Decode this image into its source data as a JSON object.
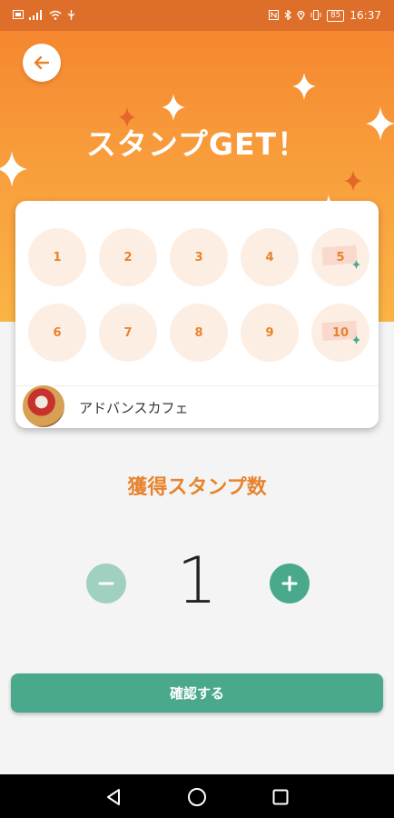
{
  "status_bar": {
    "time": "16:37",
    "battery": "85"
  },
  "header": {
    "back_icon": "arrow-left-icon",
    "title": "スタンプGET！"
  },
  "card": {
    "stamps": [
      {
        "number": "1",
        "special": false
      },
      {
        "number": "2",
        "special": false
      },
      {
        "number": "3",
        "special": false
      },
      {
        "number": "4",
        "special": false
      },
      {
        "number": "5",
        "special": true
      },
      {
        "number": "6",
        "special": false
      },
      {
        "number": "7",
        "special": false
      },
      {
        "number": "8",
        "special": false
      },
      {
        "number": "9",
        "special": false
      },
      {
        "number": "10",
        "special": true
      }
    ],
    "shop_name": "アドバンスカフェ"
  },
  "counter": {
    "label": "獲得スタンプ数",
    "value": "1",
    "minus_icon": "minus-icon",
    "plus_icon": "plus-icon"
  },
  "confirm_button": {
    "label": "確認する"
  },
  "colors": {
    "accent_orange": "#e8832d",
    "accent_green": "#4aa88c",
    "disabled_green": "#9fd0c0",
    "stamp_bg": "#fdeee3"
  },
  "nav": {
    "back_icon": "nav-back-triangle-icon",
    "home_icon": "nav-home-circle-icon",
    "recents_icon": "nav-recents-square-icon"
  }
}
